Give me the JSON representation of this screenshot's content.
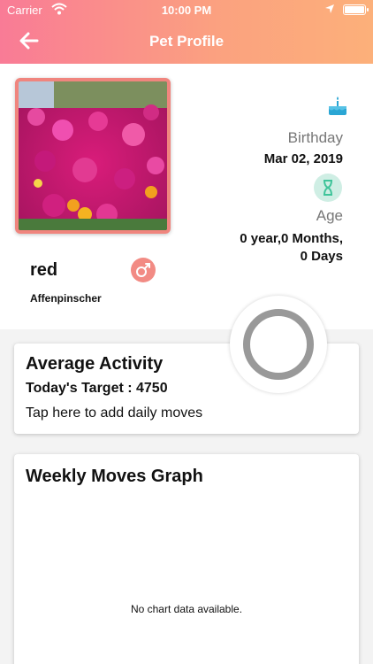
{
  "status_bar": {
    "carrier": "Carrier",
    "time": "10:00 PM"
  },
  "header": {
    "title": "Pet Profile",
    "back_icon": "arrow-left-icon",
    "gradient_start": "#f97b96",
    "gradient_end": "#fcb07a"
  },
  "pet": {
    "name": "red",
    "breed": "Affenpinscher",
    "gender_icon": "male-icon",
    "birthday_label": "Birthday",
    "birthday_value": "Mar 02, 2019",
    "age_label": "Age",
    "age_line1": "0 year,0 Months,",
    "age_line2": "0 Days"
  },
  "activity_card": {
    "title": "Average Activity",
    "target": "Today's Target : 4750",
    "tap_text": "Tap here to add daily moves"
  },
  "graph_card": {
    "title": "Weekly Moves Graph",
    "empty_text": "No chart data available."
  },
  "colors": {
    "photo_border": "#f0857e",
    "gender_badge": "#f28b84",
    "age_badge": "#cfeee4",
    "progress_ring": "#999999"
  }
}
